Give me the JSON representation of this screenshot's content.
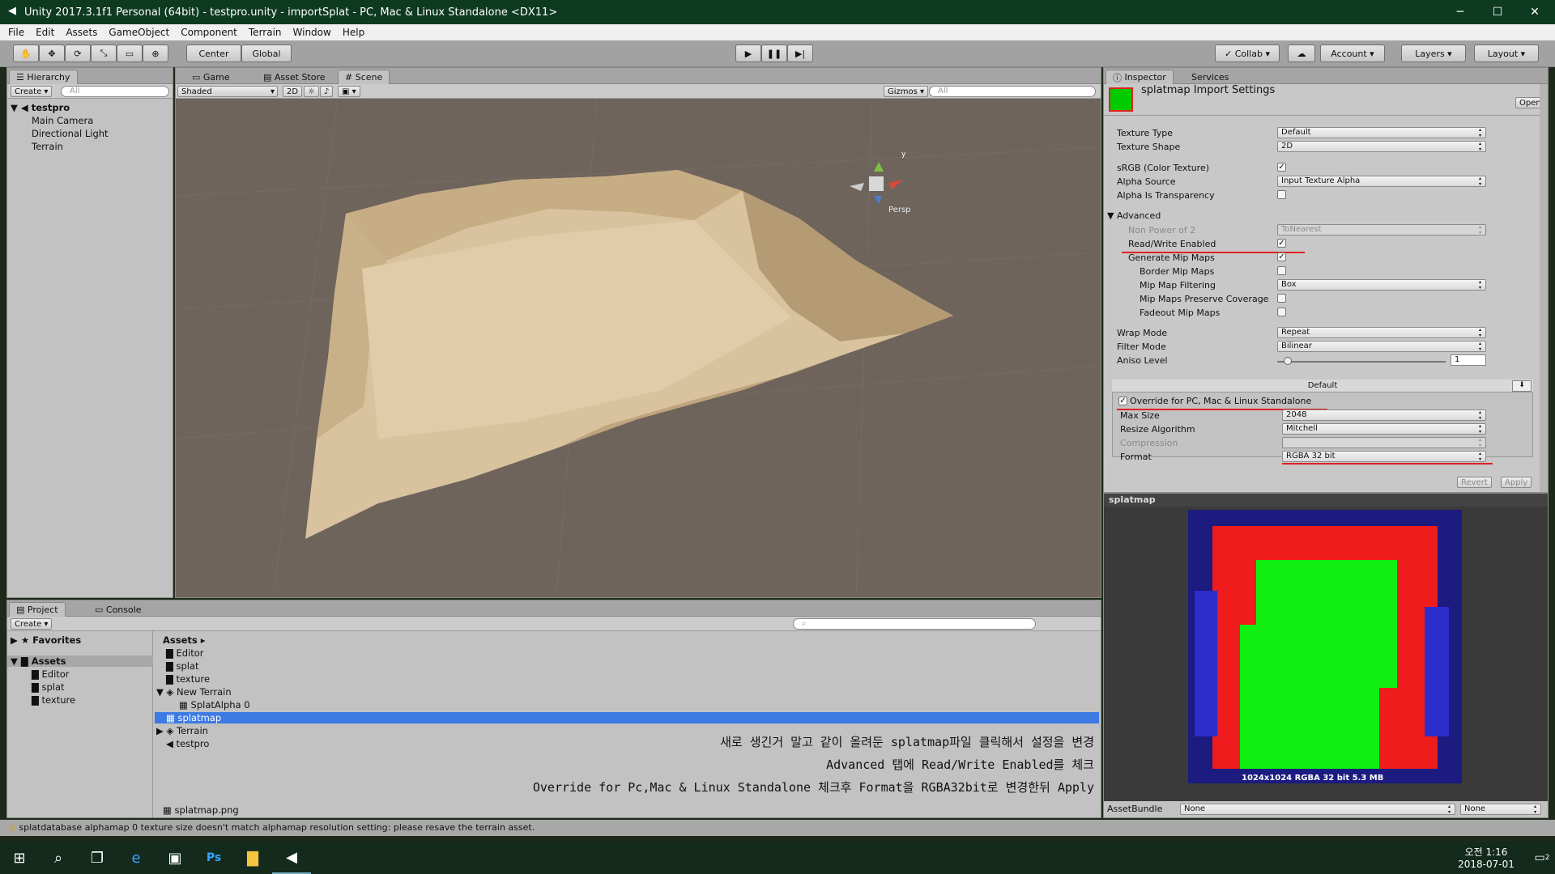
{
  "window": {
    "title": "Unity 2017.3.1f1 Personal (64bit) - testpro.unity - importSplat - PC, Mac & Linux Standalone <DX11>",
    "minimize": "─",
    "maximize": "☐",
    "close": "✕"
  },
  "menu": [
    "File",
    "Edit",
    "Assets",
    "GameObject",
    "Component",
    "Terrain",
    "Window",
    "Help"
  ],
  "toolbar": {
    "center": "Center",
    "global": "Global",
    "collab": "Collab",
    "account": "Account",
    "layers": "Layers",
    "layout": "Layout"
  },
  "hierarchy": {
    "tab": "Hierarchy",
    "create": "Create",
    "search_placeholder": "All",
    "scene": "testpro",
    "items": [
      "Main Camera",
      "Directional Light",
      "Terrain"
    ]
  },
  "scene_tabs": {
    "game": "Game",
    "asset_store": "Asset Store",
    "scene": "Scene",
    "shaded": "Shaded",
    "twod": "2D",
    "gizmos": "Gizmos",
    "search_placeholder": "All",
    "persp": "Persp",
    "axis_y": "y"
  },
  "project": {
    "tab_project": "Project",
    "tab_console": "Console",
    "create": "Create",
    "favorites": "Favorites",
    "assets_tree": "Assets",
    "tree_items": [
      "Editor",
      "splat",
      "texture"
    ],
    "breadcrumb": "Assets",
    "list": [
      {
        "name": "Editor",
        "type": "folder"
      },
      {
        "name": "splat",
        "type": "folder"
      },
      {
        "name": "texture",
        "type": "folder"
      },
      {
        "name": "New Terrain",
        "type": "terrain"
      },
      {
        "name": "SplatAlpha 0",
        "type": "tex"
      },
      {
        "name": "splatmap",
        "type": "tex",
        "selected": true
      },
      {
        "name": "Terrain",
        "type": "prefab"
      },
      {
        "name": "testpro",
        "type": "unity"
      }
    ],
    "footer_file": "splatmap.png"
  },
  "notes": [
    "새로 생긴거 말고 같이 올려둔 splatmap파일 클릭해서 설정을 변경",
    "Advanced 탭에 Read/Write Enabled를 체크",
    "Override for Pc,Mac & Linux Standalone 체크후 Format을 RGBA32bit로 변경한뒤 Apply"
  ],
  "inspector": {
    "tab": "Inspector",
    "tab2": "Services",
    "title": "splatmap Import Settings",
    "open": "Open",
    "texture_type_label": "Texture Type",
    "texture_type": "Default",
    "texture_shape_label": "Texture Shape",
    "texture_shape": "2D",
    "srgb_label": "sRGB (Color Texture)",
    "alpha_source_label": "Alpha Source",
    "alpha_source": "Input Texture Alpha",
    "alpha_transparency_label": "Alpha Is Transparency",
    "advanced_label": "Advanced",
    "npot_label": "Non Power of 2",
    "npot": "ToNearest",
    "rw_label": "Read/Write Enabled",
    "genmip_label": "Generate Mip Maps",
    "bordermip_label": "Border Mip Maps",
    "mipfilter_label": "Mip Map Filtering",
    "mipfilter": "Box",
    "mippreserve_label": "Mip Maps Preserve Coverage",
    "fademip_label": "Fadeout Mip Maps",
    "wrap_label": "Wrap Mode",
    "wrap": "Repeat",
    "filter_label": "Filter Mode",
    "filter": "Bilinear",
    "aniso_label": "Aniso Level",
    "aniso": "1",
    "platform_default": "Default",
    "override_label": "Override for PC, Mac & Linux Standalone",
    "maxsize_label": "Max Size",
    "maxsize": "2048",
    "resize_label": "Resize Algorithm",
    "resize": "Mitchell",
    "compression_label": "Compression",
    "compression": "",
    "format_label": "Format",
    "format": "RGBA 32 bit",
    "revert": "Revert",
    "apply": "Apply"
  },
  "preview": {
    "title": "splatmap",
    "info": "1024x1024  RGBA 32 bit  5.3 MB",
    "assetbundle_label": "AssetBundle",
    "ab_value": "None",
    "ab_variant": "None"
  },
  "status": {
    "warning": "splatdatabase alphamap 0 texture size doesn't match alphamap resolution setting: please resave the terrain asset."
  },
  "taskbar": {
    "time": "오전 1:16",
    "date": "2018-07-01",
    "notif": "2"
  },
  "colors": {
    "accent": "#3d7ae3",
    "red_underline": "#e02020"
  }
}
